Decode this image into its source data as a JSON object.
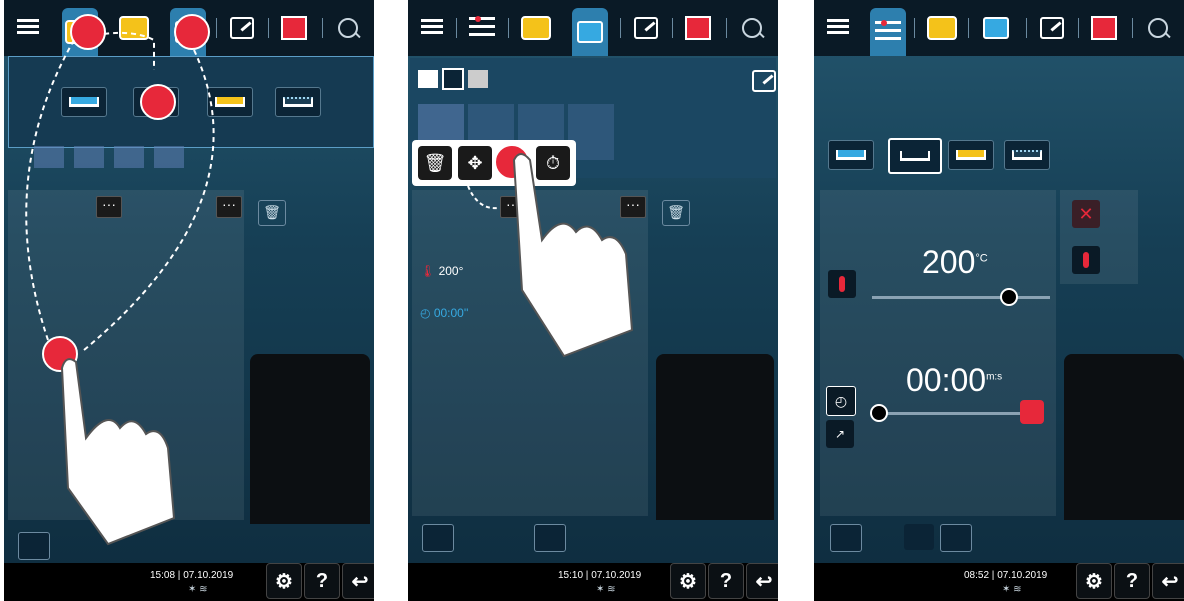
{
  "screens": [
    {
      "bottom": {
        "time": "15:08",
        "date": "07.10.2019"
      }
    },
    {
      "lane": {
        "temperature": "200",
        "temperature_unit": "°",
        "time": "00:00",
        "time_unit": "''"
      },
      "bottom": {
        "time": "15:10",
        "date": "07.10.2019"
      }
    },
    {
      "params": {
        "temperature": "200",
        "temperature_unit": "°C",
        "time": "00:00",
        "time_unit": "m:s"
      },
      "bottom": {
        "time": "08:52",
        "date": "07.10.2019"
      }
    }
  ],
  "common": {
    "settings_label": "⚙",
    "help_label": "?",
    "back_label": "↩",
    "dots_label": "···",
    "trash_label": "🗑"
  },
  "icons": {
    "menu": "menu-icon",
    "cooking_modes": "pot-icon",
    "settings_sliders": "sliders-icon",
    "view": "grid-view-icon",
    "edit": "edit-icon",
    "updown": "updown-icon",
    "search": "search-icon"
  },
  "colors": {
    "accent_red": "#e7283a",
    "accent_blue": "#2d7fae",
    "accent_yellow": "#f4c21a",
    "background": "#163f55"
  }
}
